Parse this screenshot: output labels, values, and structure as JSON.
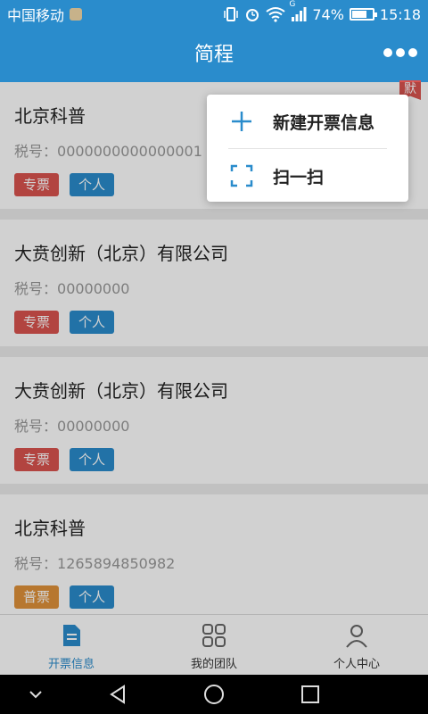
{
  "status_bar": {
    "carrier": "中国移动",
    "battery_text": "74%",
    "battery_level": 0.74,
    "network_label": "G",
    "time": "15:18"
  },
  "header": {
    "title": "简程"
  },
  "cards": [
    {
      "name": "北京科普",
      "tax_label": "税号：",
      "tax": "0000000000000001",
      "tags": [
        "专票",
        "个人"
      ],
      "default_badge": "默"
    },
    {
      "name": "大贲创新（北京）有限公司",
      "tax_label": "税号：",
      "tax": "00000000",
      "tags": [
        "专票",
        "个人"
      ]
    },
    {
      "name": "大贲创新（北京）有限公司",
      "tax_label": "税号：",
      "tax": "00000000",
      "tags": [
        "专票",
        "个人"
      ]
    },
    {
      "name": "北京科普",
      "tax_label": "税号：",
      "tax": "1265894850982",
      "tags": [
        "普票",
        "个人"
      ]
    }
  ],
  "menu": {
    "items": [
      {
        "label": "新建开票信息",
        "icon": "plus-icon"
      },
      {
        "label": "扫一扫",
        "icon": "scan-icon"
      }
    ]
  },
  "tabs": [
    {
      "label": "开票信息",
      "icon": "invoice-icon",
      "active": true
    },
    {
      "label": "我的团队",
      "icon": "grid-icon",
      "active": false
    },
    {
      "label": "个人中心",
      "icon": "person-icon",
      "active": false
    }
  ],
  "colors": {
    "primary": "#2a8ccc",
    "tag_special": "#d9534f",
    "tag_normal": "#e0923a"
  }
}
